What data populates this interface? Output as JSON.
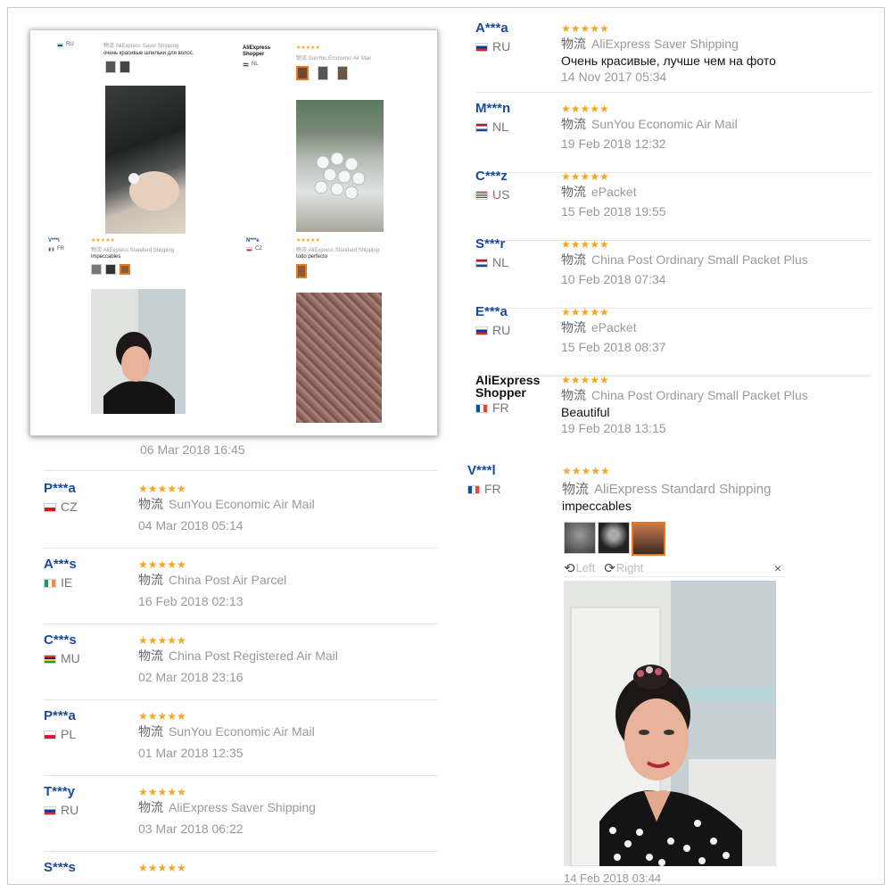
{
  "colors": {
    "name": "#1a4b9b",
    "stars": "#f5a623",
    "muted": "#999999",
    "selected": "#e8781f"
  },
  "shipping_prefix": "物流",
  "stars": "★★★★★",
  "viewer": {
    "left": "Left",
    "right": "Right",
    "close": "×"
  },
  "right_reviews": [
    {
      "name": "A***a",
      "country": "RU",
      "flag": "ru",
      "shipping": "AliExpress Saver Shipping",
      "text": "Очень красивые, лучше чем на фото",
      "date": "14 Nov 2017 05:34"
    },
    {
      "name": "M***n",
      "country": "NL",
      "flag": "nl",
      "shipping": "SunYou Economic Air Mail",
      "text": "",
      "date": "19 Feb 2018 12:32"
    },
    {
      "name": "C***z",
      "country": "US",
      "flag": "us",
      "shipping": "ePacket",
      "text": "",
      "date": "15 Feb 2018 19:55"
    },
    {
      "name": "S***r",
      "country": "NL",
      "flag": "nl",
      "shipping": "China Post Ordinary Small Packet Plus",
      "text": "",
      "date": "10 Feb 2018 07:34"
    },
    {
      "name": "E***a",
      "country": "RU",
      "flag": "ru",
      "shipping": "ePacket",
      "text": "",
      "date": "15 Feb 2018 08:37"
    },
    {
      "name": "AliExpress Shopper",
      "country": "FR",
      "flag": "fr",
      "shipping": "China Post Ordinary Small Packet Plus",
      "text": "Beautiful",
      "date": "19 Feb 2018 13:15"
    }
  ],
  "featured_review": {
    "name": "V***l",
    "country": "FR",
    "flag": "fr",
    "shipping": "AliExpress Standard Shipping",
    "text": "impeccables",
    "date": "14 Feb 2018 03:44"
  },
  "left_partial_date": "06 Mar 2018 16:45",
  "left_reviews": [
    {
      "name": "P***a",
      "country": "CZ",
      "flag": "cz",
      "shipping": "SunYou Economic Air Mail",
      "date": "04 Mar 2018 05:14"
    },
    {
      "name": "A***s",
      "country": "IE",
      "flag": "ie",
      "shipping": "China Post Air Parcel",
      "date": "16 Feb 2018 02:13"
    },
    {
      "name": "C***s",
      "country": "MU",
      "flag": "mu",
      "shipping": "China Post Registered Air Mail",
      "date": "02 Mar 2018 23:16"
    },
    {
      "name": "P***a",
      "country": "PL",
      "flag": "pl",
      "shipping": "SunYou Economic Air Mail",
      "date": "01 Mar 2018 12:35"
    },
    {
      "name": "T***y",
      "country": "RU",
      "flag": "ru",
      "shipping": "AliExpress Saver Shipping",
      "date": "03 Mar 2018 06:22"
    },
    {
      "name": "S***s",
      "country": "",
      "flag": "",
      "shipping": "",
      "date": ""
    }
  ],
  "inset": {
    "r1": {
      "country": "RU",
      "shipping": "AliExpress Saver Shipping",
      "text": "очень красивые шпильки для волос."
    },
    "r2": {
      "name": "AliExpress Shopper",
      "country": "NL",
      "shipping": "SunYou Economic Air Mail"
    },
    "r3": {
      "name": "V***l",
      "country": "FR",
      "shipping": "AliExpress Standard Shipping",
      "text": "impeccables"
    },
    "r4": {
      "name": "N***e",
      "country": "CZ",
      "shipping": "AliExpress Standard Shipping",
      "text": "todo perfecto"
    }
  }
}
